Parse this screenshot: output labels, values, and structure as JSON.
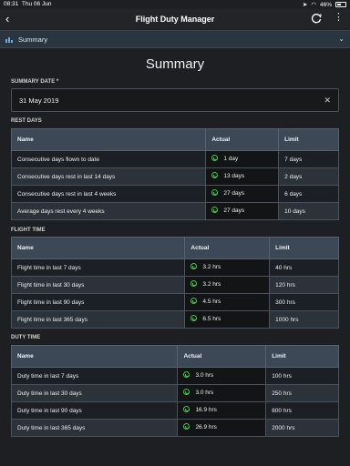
{
  "status": {
    "time": "08:31",
    "date": "Thu 06 Jun",
    "battery": "46%",
    "battery_level": 0.46
  },
  "nav": {
    "title": "Flight Duty Manager"
  },
  "section": {
    "label": "Summary"
  },
  "page_title": "Summary",
  "summary_date": {
    "label": "SUMMARY DATE *",
    "value": "31 May 2019"
  },
  "rest_days": {
    "label": "REST DAYS",
    "columns": [
      "Name",
      "Actual",
      "Limit"
    ],
    "rows": [
      {
        "name": "Consecutive days flown to date",
        "actual": "1 day",
        "limit": "7 days"
      },
      {
        "name": "Consecutive days rest in last 14 days",
        "actual": "13 days",
        "limit": "2 days"
      },
      {
        "name": "Consecutive days rest in last 4 weeks",
        "actual": "27 days",
        "limit": "6 days"
      },
      {
        "name": "Average days rest every 4 weeks",
        "actual": "27 days",
        "limit": "10 days"
      }
    ]
  },
  "flight_time": {
    "label": "FLIGHT TIME",
    "columns": [
      "Name",
      "Actual",
      "Limit"
    ],
    "rows": [
      {
        "name": "Flight time in last 7 days",
        "actual": "3.2 hrs",
        "limit": "40 hrs"
      },
      {
        "name": "Flight time in last 30 days",
        "actual": "3.2 hrs",
        "limit": "120 hrs"
      },
      {
        "name": "Flight time in last 90 days",
        "actual": "4.5 hrs",
        "limit": "300 hrs"
      },
      {
        "name": "Flight time in last 365 days",
        "actual": "6.5 hrs",
        "limit": "1000 hrs"
      }
    ]
  },
  "duty_time": {
    "label": "DUTY TIME",
    "columns": [
      "Name",
      "Actual",
      "Limit"
    ],
    "rows": [
      {
        "name": "Duty time in last 7 days",
        "actual": "3.0 hrs",
        "limit": "100 hrs"
      },
      {
        "name": "Duty time in last 30 days",
        "actual": "3.0 hrs",
        "limit": "250 hrs"
      },
      {
        "name": "Duty time in last 90 days",
        "actual": "16.9 hrs",
        "limit": "600 hrs"
      },
      {
        "name": "Duty time in last 365 days",
        "actual": "26.9 hrs",
        "limit": "2000 hrs"
      }
    ]
  },
  "icons": {
    "status_ok": "check-circle-icon",
    "back": "chevron-left-icon",
    "refresh": "refresh-icon",
    "more": "more-icon"
  },
  "colors": {
    "ok": "#44c24a",
    "header": "#3c4856"
  }
}
